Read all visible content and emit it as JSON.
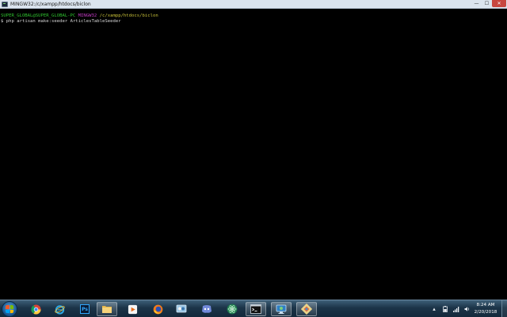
{
  "window": {
    "title": "MINGW32:/c/xampp/htdocs/biclon",
    "controls": {
      "minimize": "—",
      "maximize": "☐",
      "close": "✕"
    }
  },
  "terminal": {
    "prompt_user": "SUPER_GLOBAL@SUPER_GLOBAL-PC",
    "prompt_host": "MINGW32",
    "prompt_path": "/c/xampp/htdocs/biclon",
    "command_prefix": "$",
    "command": "php artisan make:seeder ArticlesTableSeeder"
  },
  "taskbar": {
    "start_icon": "windows-logo-icon",
    "apps": [
      {
        "name": "chrome-icon"
      },
      {
        "name": "internet-explorer-icon"
      },
      {
        "name": "photoshop-icon",
        "label": "Ps"
      },
      {
        "name": "file-explorer-icon"
      },
      {
        "name": "media-player-icon"
      },
      {
        "name": "firefox-icon"
      },
      {
        "name": "network-app-icon"
      },
      {
        "name": "discord-icon"
      },
      {
        "name": "atom-icon"
      },
      {
        "name": "terminal-icon"
      },
      {
        "name": "remote-desktop-icon"
      },
      {
        "name": "paint-icon"
      }
    ],
    "clock": {
      "time": "8:24 AM",
      "date": "2/20/2018"
    },
    "colors": {
      "accent": "#1c3448",
      "user": "#2fc22f",
      "host": "#c63cc6",
      "path": "#c9c239"
    }
  }
}
